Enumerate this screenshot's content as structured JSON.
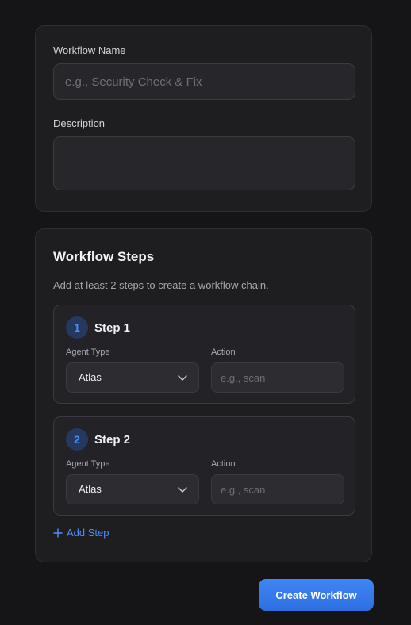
{
  "details": {
    "name_label": "Workflow Name",
    "name_placeholder": "e.g., Security Check & Fix",
    "name_value": "",
    "description_label": "Description",
    "description_value": ""
  },
  "steps_section": {
    "title": "Workflow Steps",
    "hint": "Add at least 2 steps to create a workflow chain.",
    "steps": [
      {
        "number": "1",
        "title": "Step 1",
        "agent_label": "Agent Type",
        "agent_value": "Atlas",
        "action_label": "Action",
        "action_placeholder": "e.g., scan"
      },
      {
        "number": "2",
        "title": "Step 2",
        "agent_label": "Agent Type",
        "agent_value": "Atlas",
        "action_label": "Action",
        "action_placeholder": "e.g., scan"
      }
    ],
    "add_step_label": "Add Step"
  },
  "create_button_label": "Create Workflow",
  "colors": {
    "accent": "#3b82f6",
    "background": "#151517",
    "card": "#1e1e21"
  }
}
